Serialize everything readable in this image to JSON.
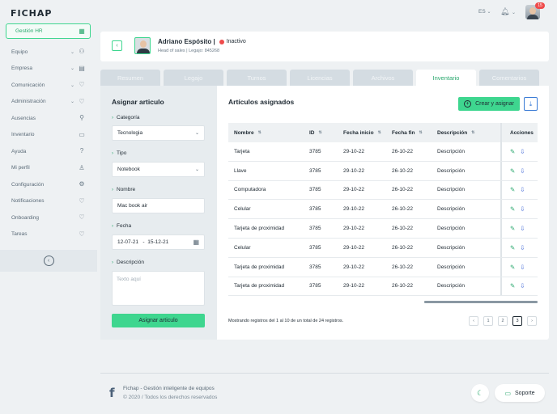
{
  "brand": {
    "logo": "FICHAP"
  },
  "sidebar": {
    "active": {
      "label": "Gestión HR"
    },
    "items": [
      {
        "label": "Equipo",
        "chevron": true,
        "icon": "users-icon"
      },
      {
        "label": "Empresa",
        "chevron": true,
        "icon": "building-icon"
      },
      {
        "label": "Comunicación",
        "chevron": true,
        "icon": "heart-icon"
      },
      {
        "label": "Administración",
        "chevron": true,
        "icon": "heart-icon"
      },
      {
        "label": "Ausencias",
        "chevron": false,
        "icon": "user-minus-icon"
      },
      {
        "label": "Inventario",
        "chevron": false,
        "icon": "book-icon"
      },
      {
        "label": "Ayuda",
        "chevron": false,
        "icon": "help-icon"
      },
      {
        "label": "Mi perfil",
        "chevron": false,
        "icon": "user-icon"
      },
      {
        "label": "Configuración",
        "chevron": false,
        "icon": "gear-icon"
      },
      {
        "label": "Notificaciones",
        "chevron": false,
        "icon": "heart-icon"
      },
      {
        "label": "Onboarding",
        "chevron": false,
        "icon": "heart-icon"
      },
      {
        "label": "Tareas",
        "chevron": false,
        "icon": "heart-icon"
      }
    ]
  },
  "topbar": {
    "lang": "ES",
    "badge": "15"
  },
  "profile": {
    "name": "Adriano Espósito |",
    "status": "Inactivo",
    "subtitle": "Head of sales  |  Legajo: 845268"
  },
  "tabs": [
    {
      "label": "Resumen",
      "active": false
    },
    {
      "label": "Legajo",
      "active": false
    },
    {
      "label": "Turnos",
      "active": false
    },
    {
      "label": "Licencias",
      "active": false
    },
    {
      "label": "Archivos",
      "active": false
    },
    {
      "label": "Inventario",
      "active": true
    },
    {
      "label": "Comentarios",
      "active": false
    }
  ],
  "assign": {
    "title": "Asignar articulo",
    "categoria_label": "Categoría",
    "categoria_value": "Tecnologia",
    "tipo_label": "Tipo",
    "tipo_value": "Notebook",
    "nombre_label": "Nombre",
    "nombre_value": "Mac book air",
    "fecha_label": "Fecha",
    "fecha_value": "12-07-21   -  15-12-21",
    "descripcion_label": "Descripción",
    "descripcion_placeholder": "Texto aquí",
    "button": "Asignar articulo"
  },
  "list": {
    "title": "Artículos asignados",
    "create_button": "Crear y asignar",
    "columns": [
      "Nombre",
      "ID",
      "Fecha inicio",
      "Fecha fin",
      "Descripción",
      "Acciones"
    ],
    "rows": [
      {
        "name": "Tarjeta",
        "id": "3785",
        "start": "29-10-22",
        "end": "26-10-22",
        "desc": "Descripción"
      },
      {
        "name": "Llave",
        "id": "3785",
        "start": "29-10-22",
        "end": "26-10-22",
        "desc": "Descripción"
      },
      {
        "name": "Computadora",
        "id": "3785",
        "start": "29-10-22",
        "end": "26-10-22",
        "desc": "Descripción"
      },
      {
        "name": "Celular",
        "id": "3785",
        "start": "29-10-22",
        "end": "26-10-22",
        "desc": "Descripción"
      },
      {
        "name": "Tarjeta de proximidad",
        "id": "3785",
        "start": "29-10-22",
        "end": "26-10-22",
        "desc": "Descripción"
      },
      {
        "name": "Celular",
        "id": "3785",
        "start": "29-10-22",
        "end": "26-10-22",
        "desc": "Descripción"
      },
      {
        "name": "Tarjeta de proximidad",
        "id": "3785",
        "start": "29-10-22",
        "end": "26-10-22",
        "desc": "Descripción"
      },
      {
        "name": "Tarjeta de proximidad",
        "id": "3785",
        "start": "29-10-22",
        "end": "26-10-22",
        "desc": "Descripción"
      }
    ],
    "footer": "Mostrando registros del 1 al 10 de un total de 24 registros.",
    "pages": [
      "1",
      "2",
      "3"
    ],
    "active_page": "3"
  },
  "footer": {
    "title": "Fichap - Gestión inteligente de equipos",
    "copyright": "© 2020 / Todos los derechos reservados",
    "support": "Soporte"
  }
}
